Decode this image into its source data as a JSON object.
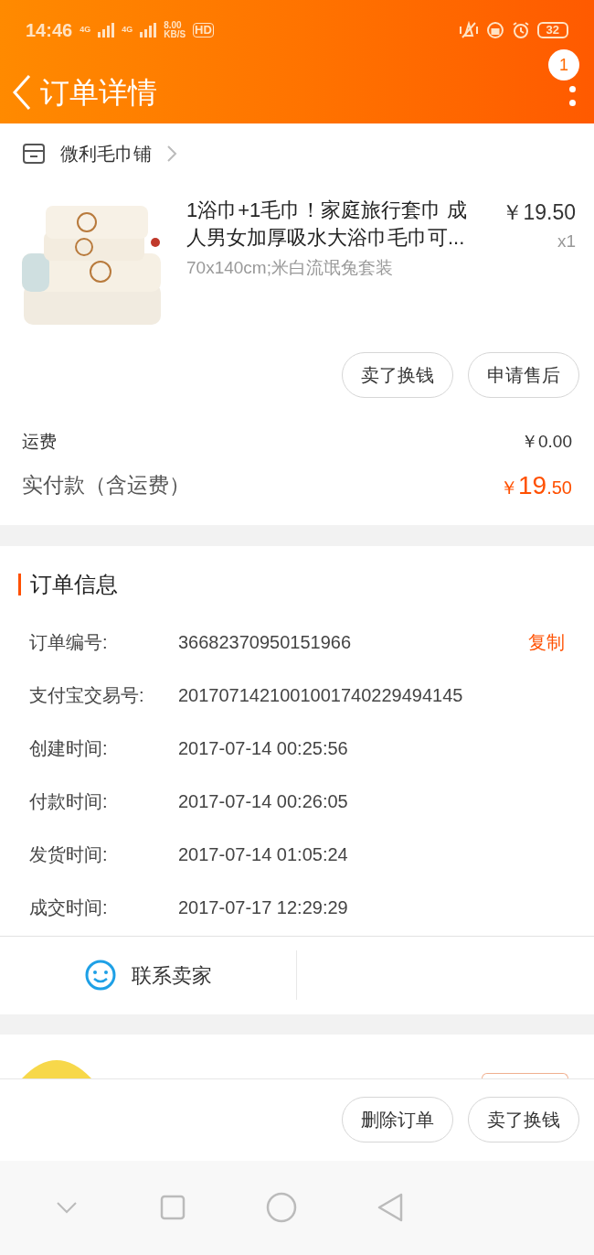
{
  "status_bar": {
    "time": "14:46",
    "net1": "4G",
    "net2": "4G",
    "speed_value": "8.00",
    "speed_unit": "KB/S",
    "hd": "HD",
    "battery": "32"
  },
  "header": {
    "title": "订单详情",
    "badge": "1"
  },
  "shop": {
    "name": "微利毛巾铺"
  },
  "product": {
    "title": "1浴巾+1毛巾！家庭旅行套巾 成人男女加厚吸水大浴巾毛巾可...",
    "price": "￥19.50",
    "quantity": "x1",
    "sku": "70x140cm;米白流氓兔套装"
  },
  "item_actions": [
    "卖了换钱",
    "申请售后"
  ],
  "fees": [
    {
      "label": "运费",
      "value": "￥0.00",
      "kind": "plain"
    },
    {
      "label": "实付款（含运费）",
      "currency": "￥",
      "integer": "19",
      "decimal": ".50",
      "kind": "total"
    }
  ],
  "order_info": {
    "title": "订单信息",
    "copy_label": "复制",
    "rows": [
      {
        "label": "订单编号:",
        "value": "36682370950151966"
      },
      {
        "label": "支付宝交易号:",
        "value": "2017071421001001740229494145"
      },
      {
        "label": "创建时间:",
        "value": "2017-07-14 00:25:56"
      },
      {
        "label": "付款时间:",
        "value": "2017-07-14 00:26:05"
      },
      {
        "label": "发货时间:",
        "value": "2017-07-14 01:05:24"
      },
      {
        "label": "成交时间:",
        "value": "2017-07-17 12:29:29"
      }
    ]
  },
  "contact": {
    "label": "联系卖家"
  },
  "bottom_actions": [
    "删除订单",
    "卖了换钱"
  ]
}
